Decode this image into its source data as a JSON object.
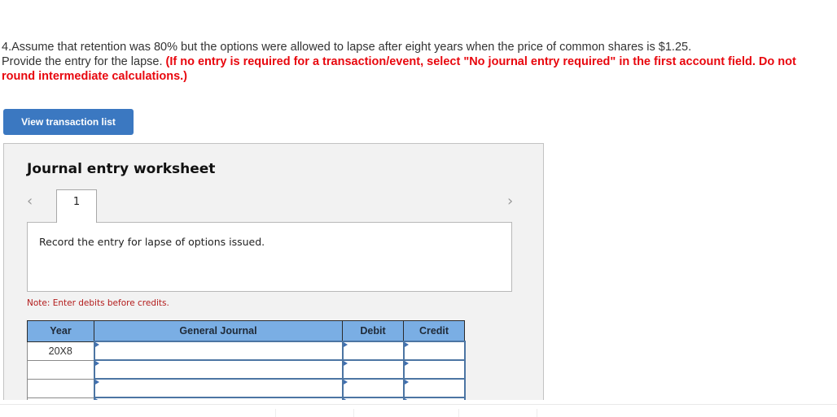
{
  "question": {
    "line1": "4.Assume that retention was 80% but the options were allowed to lapse after eight years when the price of common shares is $1.25.",
    "line2_plain": "Provide the entry for the lapse. ",
    "instruction": "(If no entry is required for a transaction/event, select \"No journal entry required\" in the first account field. Do not round intermediate calculations.)"
  },
  "buttons": {
    "view_transaction_list": "View transaction list"
  },
  "worksheet": {
    "title": "Journal entry worksheet",
    "nav_prev_icon": "‹",
    "nav_next_icon": "›",
    "tabs": [
      "1"
    ],
    "description": "Record the entry for lapse of options issued.",
    "note": "Note: Enter debits before credits.",
    "table": {
      "headers": [
        "Year",
        "General Journal",
        "Debit",
        "Credit"
      ],
      "rows": [
        {
          "year": "20X8",
          "account": "",
          "debit": "",
          "credit": ""
        },
        {
          "year": "",
          "account": "",
          "debit": "",
          "credit": ""
        },
        {
          "year": "",
          "account": "",
          "debit": "",
          "credit": ""
        },
        {
          "year": "",
          "account": "",
          "debit": "",
          "credit": ""
        }
      ]
    }
  },
  "colors": {
    "accent": "#3b78c1",
    "header": "#7aaee4",
    "instruction_red": "#e8070e",
    "note_red": "#b31b1b"
  }
}
